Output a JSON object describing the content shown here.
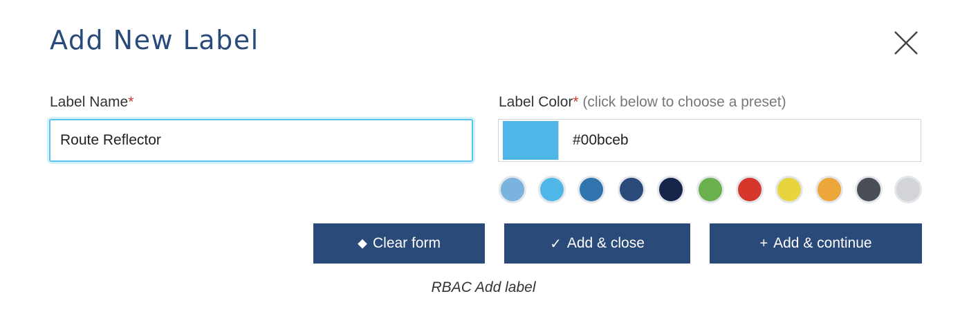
{
  "dialog": {
    "title": "Add New Label",
    "close_icon": "close-icon"
  },
  "label_name": {
    "label": "Label Name",
    "required_mark": "*",
    "value": "Route Reflector"
  },
  "label_color": {
    "label": "Label Color",
    "required_mark": "*",
    "hint": " (click below to choose a preset)",
    "preview_color": "#4fb7e8",
    "value": "#00bceb",
    "presets": [
      "#7ab3de",
      "#4fb7e8",
      "#2f74ad",
      "#2a4a7a",
      "#15264a",
      "#6ab04c",
      "#d6372b",
      "#e8d43c",
      "#eda63a",
      "#4a4f55",
      "#d2d4d7"
    ]
  },
  "buttons": {
    "clear": {
      "icon": "eraser-icon",
      "glyph": "⬥",
      "label": "Clear form"
    },
    "add_close": {
      "icon": "checkmark-icon",
      "glyph": "✓",
      "label": "Add & close"
    },
    "add_continue": {
      "icon": "plus-icon",
      "glyph": "+",
      "label": "Add & continue"
    }
  },
  "caption": "RBAC Add label"
}
